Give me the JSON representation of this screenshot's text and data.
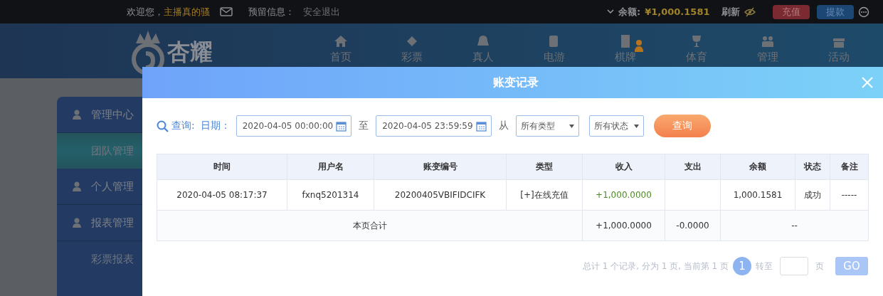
{
  "top_bar": {
    "greeting": "欢迎您，",
    "username": "主播真的骚",
    "reserved_info": "预留信息：",
    "logout": "安全退出",
    "balance_label": "余额:",
    "balance": "¥1,000.1581",
    "refresh": "刷新",
    "deposit": "充值",
    "withdraw": "提款"
  },
  "logo": {
    "text": "杏耀"
  },
  "nav": [
    {
      "label": "首页",
      "badge": false
    },
    {
      "label": "彩票",
      "badge": false
    },
    {
      "label": "真人",
      "badge": false
    },
    {
      "label": "电游",
      "badge": false
    },
    {
      "label": "棋牌",
      "badge": true
    },
    {
      "label": "体育",
      "badge": false
    },
    {
      "label": "管理",
      "badge": false
    },
    {
      "label": "活动",
      "badge": false
    }
  ],
  "sidebar": [
    {
      "label": "管理中心",
      "children": [
        {
          "label": "团队管理",
          "selected": true
        }
      ]
    },
    {
      "label": "个人管理"
    },
    {
      "label": "报表管理",
      "children": [
        {
          "label": "彩票报表",
          "selected": false
        }
      ]
    }
  ],
  "modal": {
    "title": "账变记录",
    "query": {
      "label": "查询:",
      "date_label": "日期：",
      "start": "2020-04-05 00:00:00",
      "to": "至",
      "end": "2020-04-05 23:59:59",
      "from": "从",
      "type_select": "所有类型",
      "status_select": "所有状态",
      "button": "查询"
    },
    "table": {
      "columns": [
        "时间",
        "用户名",
        "账变编号",
        "类型",
        "收入",
        "支出",
        "余额",
        "状态",
        "备注"
      ],
      "rows": [
        [
          "2020-04-05 08:17:37",
          "fxnq5201314",
          "20200405VBIFIDCIFK",
          "[+]在线充值",
          "+1,000.0000",
          "",
          "1,000.1581",
          "成功",
          "-----"
        ]
      ],
      "total": {
        "label": "本页合计",
        "income": "+1,000.0000",
        "expense": "-0.0000",
        "rest": "--"
      }
    },
    "pagination": {
      "summary": "总计 1 个记录, 分为 1 页, 当前第 1 页",
      "pages": [
        {
          "label": "1",
          "selected": true
        }
      ],
      "goto": "转至",
      "page_unit": "页",
      "go": "GO"
    }
  }
}
